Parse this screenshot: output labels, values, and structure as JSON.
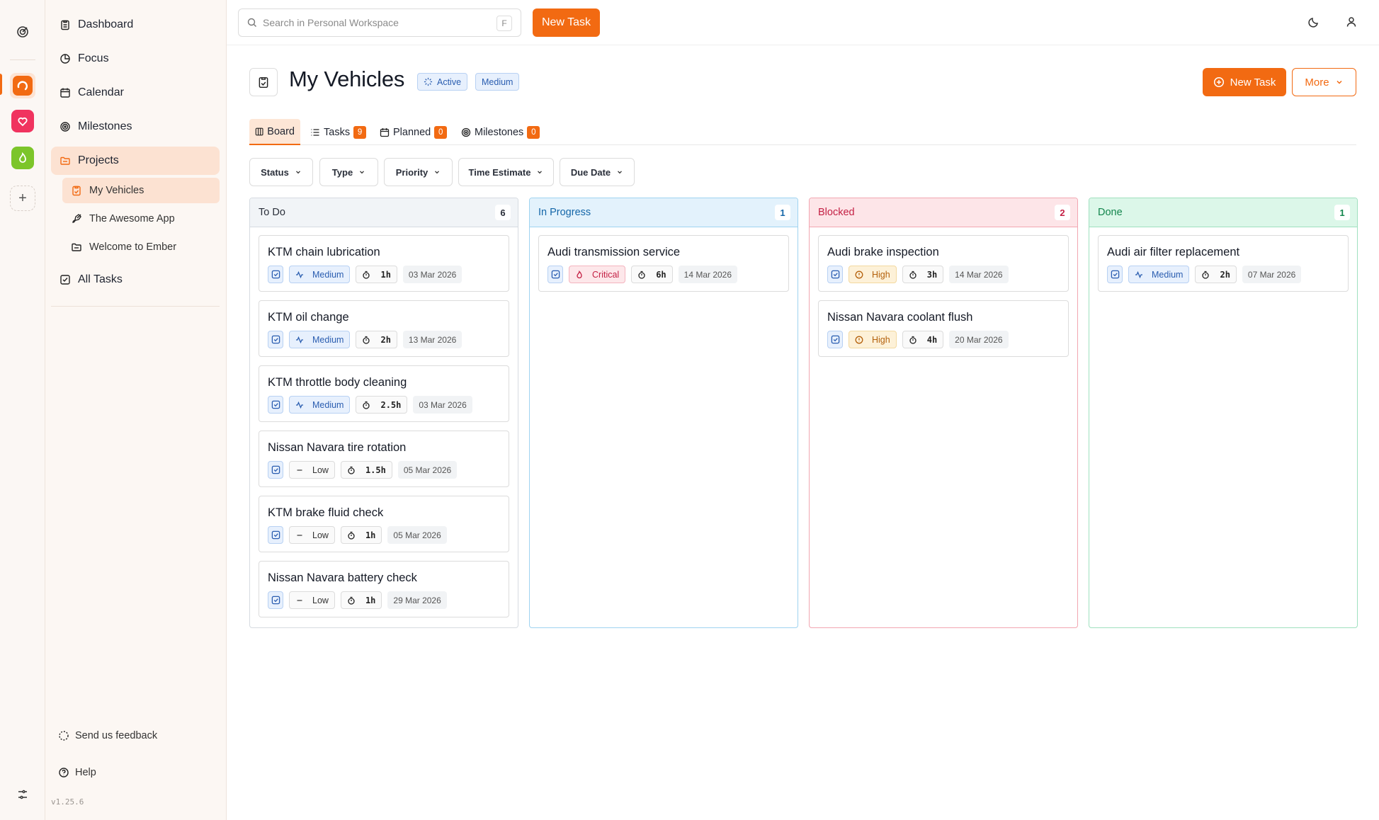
{
  "search": {
    "placeholder": "Search in Personal Workspace",
    "shortcut": "F"
  },
  "topbar": {
    "new_task_label": "New Task"
  },
  "sidebar": {
    "items": [
      {
        "label": "Dashboard"
      },
      {
        "label": "Focus"
      },
      {
        "label": "Calendar"
      },
      {
        "label": "Milestones"
      },
      {
        "label": "Projects"
      },
      {
        "label": "All Tasks"
      }
    ],
    "projects": [
      {
        "label": "My Vehicles"
      },
      {
        "label": "The Awesome App"
      },
      {
        "label": "Welcome to Ember"
      }
    ],
    "feedback_label": "Send us feedback",
    "help_label": "Help",
    "version": "v1.25.6"
  },
  "workspaces": [
    {
      "color": "#f26a12"
    },
    {
      "color": "#f0335f"
    },
    {
      "color": "#7cc52a"
    }
  ],
  "header": {
    "title": "My Vehicles",
    "status_badge": "Active",
    "priority_badge": "Medium",
    "new_task_label": "New Task",
    "more_label": "More"
  },
  "tabs": [
    {
      "label": "Board",
      "count": ""
    },
    {
      "label": "Tasks",
      "count": "9"
    },
    {
      "label": "Planned",
      "count": "0"
    },
    {
      "label": "Milestones",
      "count": "0"
    }
  ],
  "filters": [
    "Status",
    "Type",
    "Priority",
    "Time Estimate",
    "Due Date"
  ],
  "columns": [
    {
      "title": "To Do",
      "count": "6",
      "cards": [
        {
          "title": "KTM chain lubrication",
          "priority": "Medium",
          "time": "1h",
          "date": "03 Mar 2026"
        },
        {
          "title": "KTM oil change",
          "priority": "Medium",
          "time": "2h",
          "date": "13 Mar 2026"
        },
        {
          "title": "KTM throttle body cleaning",
          "priority": "Medium",
          "time": "2.5h",
          "date": "03 Mar 2026"
        },
        {
          "title": "Nissan Navara tire rotation",
          "priority": "Low",
          "time": "1.5h",
          "date": "05 Mar 2026"
        },
        {
          "title": "KTM brake fluid check",
          "priority": "Low",
          "time": "1h",
          "date": "05 Mar 2026"
        },
        {
          "title": "Nissan Navara battery check",
          "priority": "Low",
          "time": "1h",
          "date": "29 Mar 2026"
        }
      ]
    },
    {
      "title": "In Progress",
      "count": "1",
      "cards": [
        {
          "title": "Audi transmission service",
          "priority": "Critical",
          "time": "6h",
          "date": "14 Mar 2026"
        }
      ]
    },
    {
      "title": "Blocked",
      "count": "2",
      "cards": [
        {
          "title": "Audi brake inspection",
          "priority": "High",
          "time": "3h",
          "date": "14 Mar 2026"
        },
        {
          "title": "Nissan Navara coolant flush",
          "priority": "High",
          "time": "4h",
          "date": "20 Mar 2026"
        }
      ]
    },
    {
      "title": "Done",
      "count": "1",
      "cards": [
        {
          "title": "Audi air filter replacement",
          "priority": "Medium",
          "time": "2h",
          "date": "07 Mar 2026"
        }
      ]
    }
  ]
}
